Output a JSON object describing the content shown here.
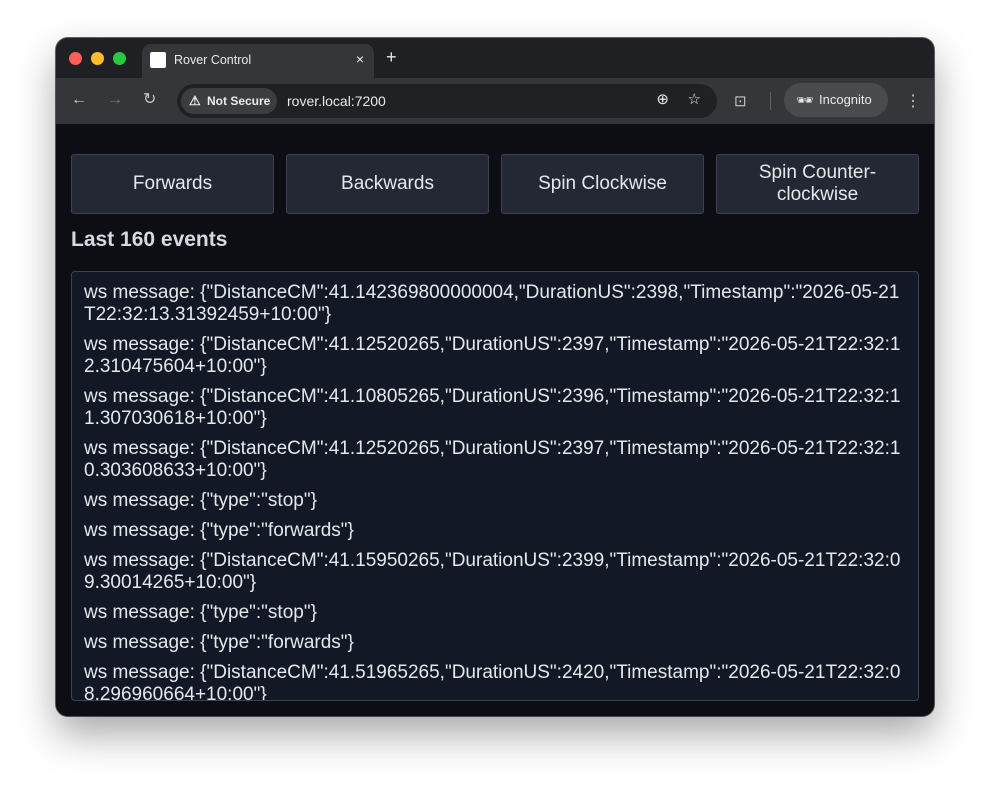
{
  "browser": {
    "tab_title": "Rover Control",
    "tab_close": "×",
    "new_tab": "+",
    "security_label": "Not Secure",
    "url": "rover.local:7200",
    "incognito_label": "Incognito",
    "icons": {
      "back": "←",
      "forward": "→",
      "reload": "↻",
      "warning": "⚠",
      "zoom": "⊕",
      "star": "☆",
      "tab_search": "⊡",
      "incognito": "🕶",
      "menu": "⋮"
    },
    "colors": {
      "close": "#ff5f57",
      "minimize": "#febc2e",
      "maximize": "#28c840"
    }
  },
  "controls": [
    {
      "label": "Forwards"
    },
    {
      "label": "Backwards"
    },
    {
      "label": "Spin Clockwise"
    },
    {
      "label": "Spin Counter-clockwise"
    }
  ],
  "events": {
    "heading": "Last 160 events",
    "items": [
      "ws message: {\"DistanceCM\":41.142369800000004,\"DurationUS\":2398,\"Timestamp\":\"2026-05-21T22:32:13.31392459+10:00\"}",
      "ws message: {\"DistanceCM\":41.12520265,\"DurationUS\":2397,\"Timestamp\":\"2026-05-21T22:32:12.310475604+10:00\"}",
      "ws message: {\"DistanceCM\":41.10805265,\"DurationUS\":2396,\"Timestamp\":\"2026-05-21T22:32:11.307030618+10:00\"}",
      "ws message: {\"DistanceCM\":41.12520265,\"DurationUS\":2397,\"Timestamp\":\"2026-05-21T22:32:10.303608633+10:00\"}",
      "ws message: {\"type\":\"stop\"}",
      "ws message: {\"type\":\"forwards\"}",
      "ws message: {\"DistanceCM\":41.15950265,\"DurationUS\":2399,\"Timestamp\":\"2026-05-21T22:32:09.30014265+10:00\"}",
      "ws message: {\"type\":\"stop\"}",
      "ws message: {\"type\":\"forwards\"}",
      "ws message: {\"DistanceCM\":41.51965265,\"DurationUS\":2420,\"Timestamp\":\"2026-05-21T22:32:08.296960664+10:00\"}"
    ]
  }
}
